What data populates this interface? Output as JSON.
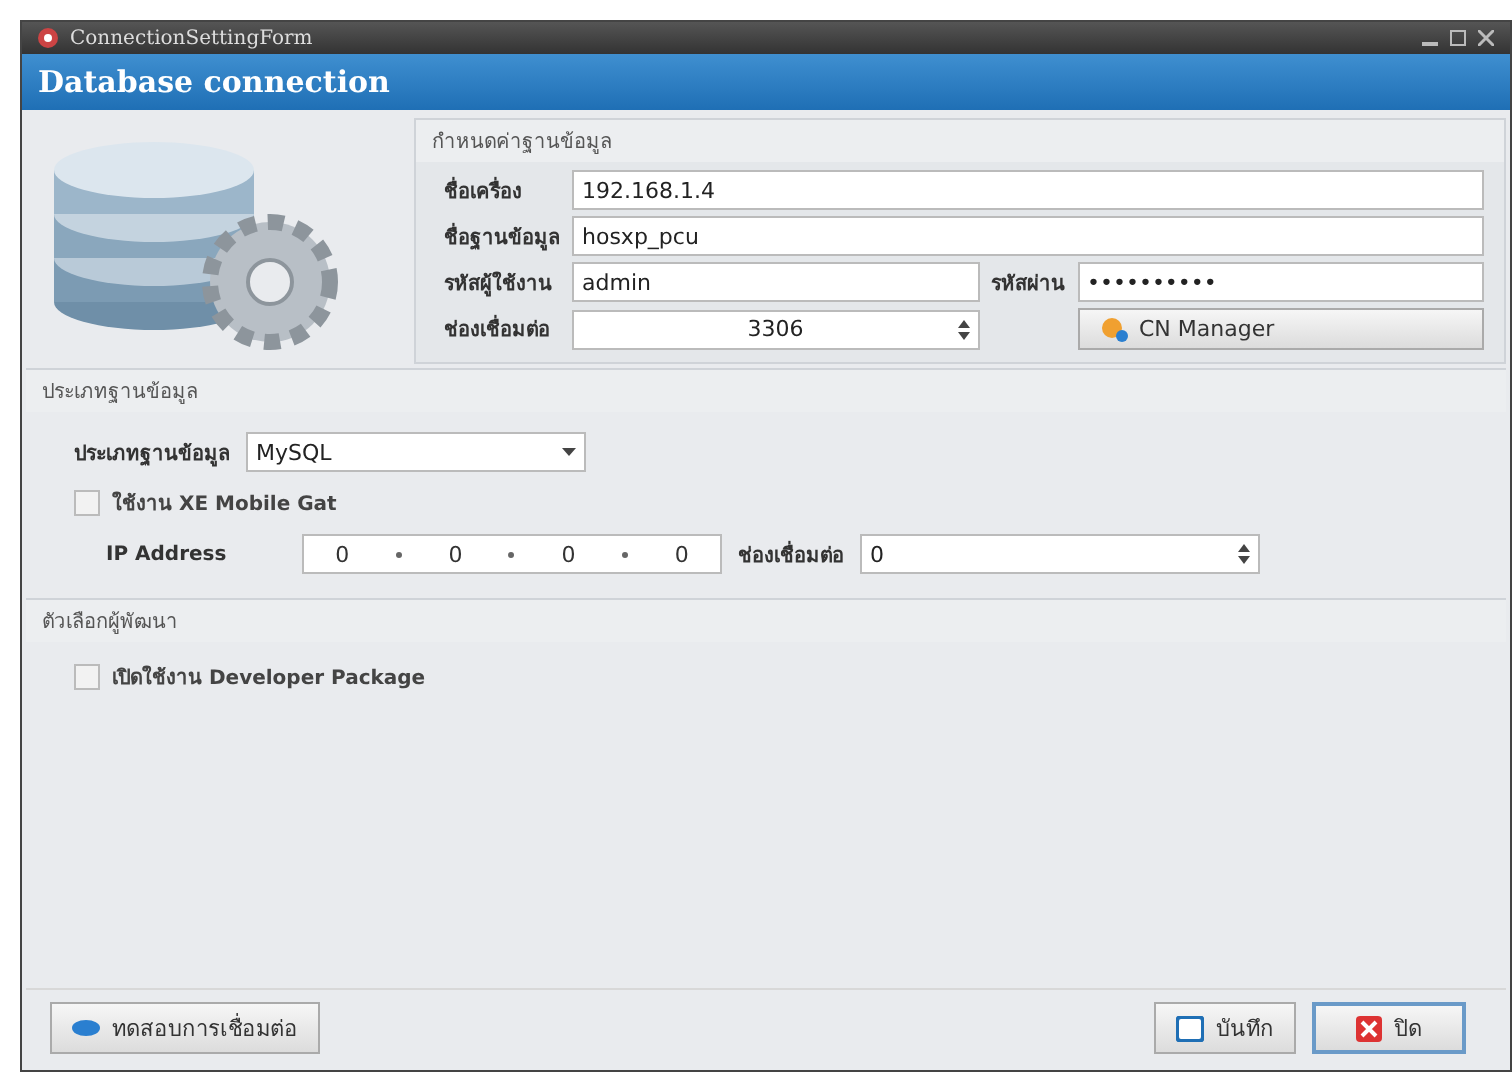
{
  "window": {
    "title": "ConnectionSettingForm"
  },
  "header": {
    "title": "Database connection"
  },
  "database_settings": {
    "legend": "กำหนดค่าฐานข้อมูล",
    "host": {
      "label": "ชื่อเครื่อง",
      "value": "192.168.1.4"
    },
    "database": {
      "label": "ชื่อฐานข้อมูล",
      "value": "hosxp_pcu"
    },
    "username": {
      "label": "รหัสผู้ใช้งาน",
      "value": "admin"
    },
    "password": {
      "label": "รหัสผ่าน",
      "value": "••••••••••"
    },
    "port": {
      "label": "ช่องเชื่อมต่อ",
      "value": "3306"
    },
    "cn_manager_button": "CN Manager"
  },
  "database_type": {
    "legend": "ประเภทฐานข้อมูล",
    "label": "ประเภทฐานข้อมูล",
    "value": "MySQL",
    "xe_mobile": {
      "label": "ใช้งาน XE Mobile Gat",
      "checked": false
    },
    "ip_address": {
      "label": "IP Address",
      "octets": [
        "0",
        "0",
        "0",
        "0"
      ]
    },
    "port": {
      "label": "ช่องเชื่อมต่อ",
      "value": "0"
    }
  },
  "developer_options": {
    "legend": "ตัวเลือกผู้พัฒนา",
    "developer_package": {
      "label": "เปิดใช้งาน Developer Package",
      "checked": false
    }
  },
  "buttons": {
    "test": "ทดสอบการเชื่อมต่อ",
    "save": "บันทึก",
    "close": "ปิด"
  }
}
